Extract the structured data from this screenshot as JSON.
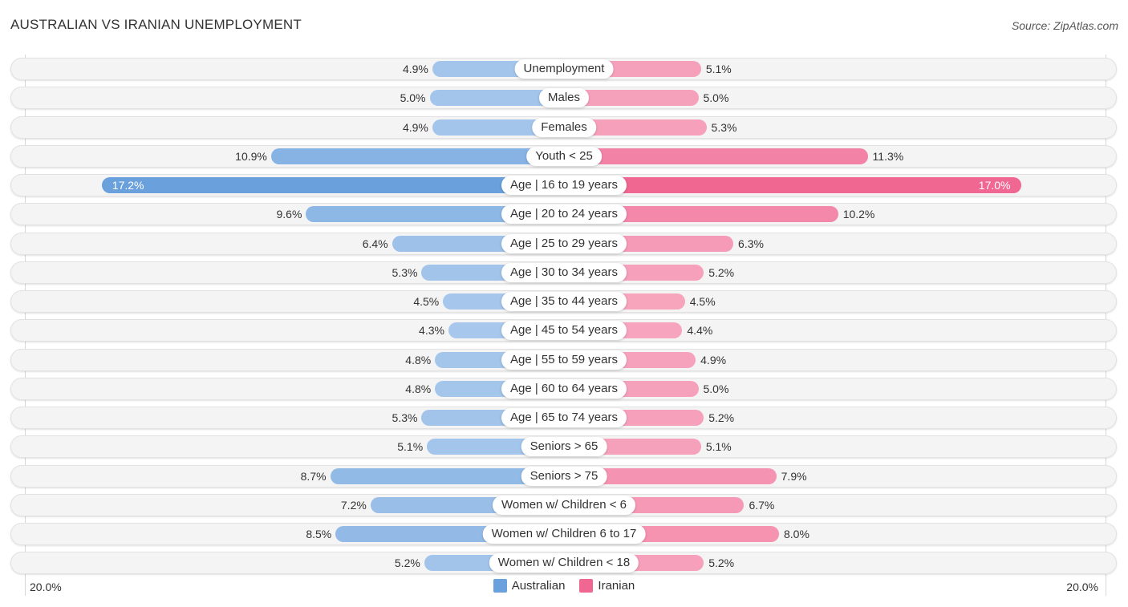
{
  "header": {
    "title": "AUSTRALIAN VS IRANIAN UNEMPLOYMENT",
    "source": "Source: ZipAtlas.com"
  },
  "colors": {
    "australian": "#6aa0dc",
    "australian_light": "#a8c8ec",
    "iranian": "#f06792",
    "iranian_light": "#f7a6bf"
  },
  "chart_data": {
    "type": "bar",
    "orientation": "diverging-horizontal",
    "title": "AUSTRALIAN VS IRANIAN UNEMPLOYMENT",
    "xlabel": "",
    "ylabel": "",
    "xlim": [
      -20,
      20
    ],
    "axis_labels": {
      "left": "20.0%",
      "right": "20.0%"
    },
    "legend_position": "bottom-center",
    "categories": [
      "Unemployment",
      "Males",
      "Females",
      "Youth < 25",
      "Age | 16 to 19 years",
      "Age | 20 to 24 years",
      "Age | 25 to 29 years",
      "Age | 30 to 34 years",
      "Age | 35 to 44 years",
      "Age | 45 to 54 years",
      "Age | 55 to 59 years",
      "Age | 60 to 64 years",
      "Age | 65 to 74 years",
      "Seniors > 65",
      "Seniors > 75",
      "Women w/ Children < 6",
      "Women w/ Children 6 to 17",
      "Women w/ Children < 18"
    ],
    "series": [
      {
        "name": "Australian",
        "side": "left",
        "values": [
          4.9,
          5.0,
          4.9,
          10.9,
          17.2,
          9.6,
          6.4,
          5.3,
          4.5,
          4.3,
          4.8,
          4.8,
          5.3,
          5.1,
          8.7,
          7.2,
          8.5,
          5.2
        ],
        "labels": [
          "4.9%",
          "5.0%",
          "4.9%",
          "10.9%",
          "17.2%",
          "9.6%",
          "6.4%",
          "5.3%",
          "4.5%",
          "4.3%",
          "4.8%",
          "4.8%",
          "5.3%",
          "5.1%",
          "8.7%",
          "7.2%",
          "8.5%",
          "5.2%"
        ]
      },
      {
        "name": "Iranian",
        "side": "right",
        "values": [
          5.1,
          5.0,
          5.3,
          11.3,
          17.0,
          10.2,
          6.3,
          5.2,
          4.5,
          4.4,
          4.9,
          5.0,
          5.2,
          5.1,
          7.9,
          6.7,
          8.0,
          5.2
        ],
        "labels": [
          "5.1%",
          "5.0%",
          "5.3%",
          "11.3%",
          "17.0%",
          "10.2%",
          "6.3%",
          "5.2%",
          "4.5%",
          "4.4%",
          "4.9%",
          "5.0%",
          "5.2%",
          "5.1%",
          "7.9%",
          "6.7%",
          "8.0%",
          "5.2%"
        ]
      }
    ]
  },
  "legend": {
    "items": [
      {
        "label": "Australian"
      },
      {
        "label": "Iranian"
      }
    ]
  }
}
